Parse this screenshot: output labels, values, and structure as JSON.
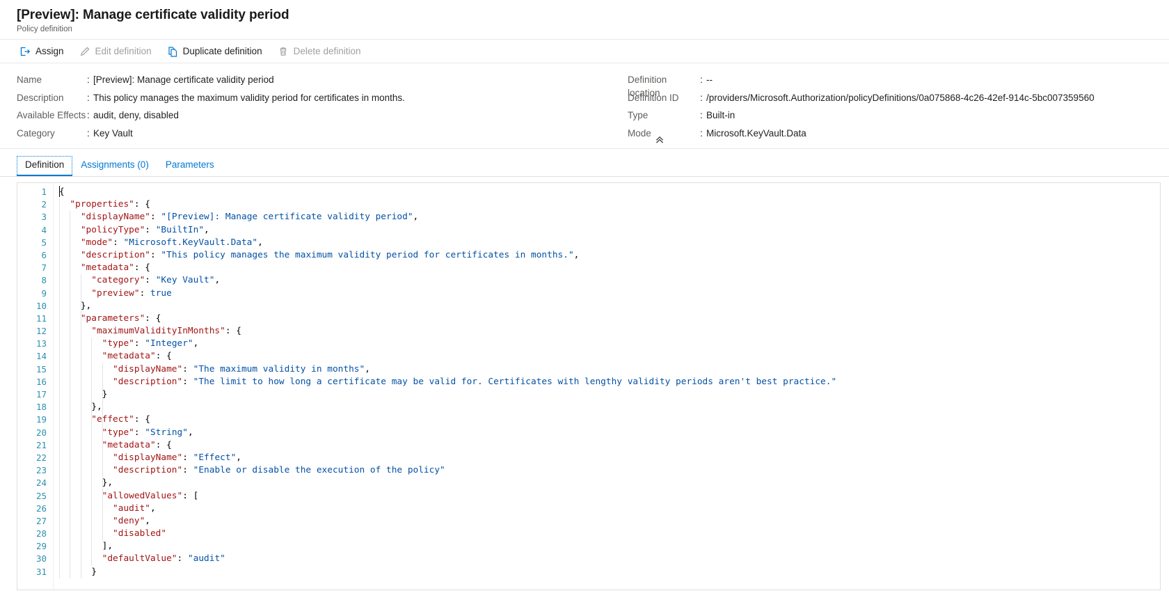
{
  "header": {
    "title": "[Preview]: Manage certificate validity period",
    "subtitle": "Policy definition"
  },
  "command_bar": {
    "items": [
      {
        "label": "Assign",
        "icon": "assign-icon",
        "disabled": false
      },
      {
        "label": "Edit definition",
        "icon": "pencil-icon",
        "disabled": true
      },
      {
        "label": "Duplicate definition",
        "icon": "copy-icon",
        "disabled": false
      },
      {
        "label": "Delete definition",
        "icon": "trash-icon",
        "disabled": true
      }
    ]
  },
  "properties": {
    "separator": ":",
    "left": [
      {
        "label": "Name",
        "value": "[Preview]: Manage certificate validity period"
      },
      {
        "label": "Description",
        "value": "This policy manages the maximum validity period for certificates in months."
      },
      {
        "label": "Available Effects",
        "value": "audit, deny, disabled"
      },
      {
        "label": "Category",
        "value": "Key Vault"
      }
    ],
    "right": [
      {
        "label": "Definition location",
        "value": "--"
      },
      {
        "label": "Definition ID",
        "value": "/providers/Microsoft.Authorization/policyDefinitions/0a075868-4c26-42ef-914c-5bc007359560"
      },
      {
        "label": "Type",
        "value": "Built-in"
      },
      {
        "label": "Mode",
        "value": "Microsoft.KeyVault.Data"
      }
    ],
    "collapse_icon": "chevron-double-up-icon"
  },
  "tabs": [
    {
      "label": "Definition",
      "active": true
    },
    {
      "label": "Assignments (0)",
      "active": false
    },
    {
      "label": "Parameters",
      "active": false
    }
  ],
  "editor": {
    "language": "json",
    "first_visible_line": 1,
    "last_visible_line": 31,
    "colors": {
      "key": "#a31515",
      "string": "#0451a5",
      "punctuation": "#000000",
      "line_number": "#2b91af"
    },
    "line_numbers": [
      1,
      2,
      3,
      4,
      5,
      6,
      7,
      8,
      9,
      10,
      11,
      12,
      13,
      14,
      15,
      16,
      17,
      18,
      19,
      20,
      21,
      22,
      23,
      24,
      25,
      26,
      27,
      28,
      29,
      30,
      31
    ],
    "lines": [
      {
        "n": 1,
        "indent": 0,
        "tokens": [
          {
            "t": "pun",
            "v": "{"
          }
        ]
      },
      {
        "n": 2,
        "indent": 1,
        "tokens": [
          {
            "t": "key",
            "v": "\"properties\""
          },
          {
            "t": "pun",
            "v": ": {"
          }
        ]
      },
      {
        "n": 3,
        "indent": 2,
        "tokens": [
          {
            "t": "key",
            "v": "\"displayName\""
          },
          {
            "t": "pun",
            "v": ": "
          },
          {
            "t": "str",
            "v": "\"[Preview]: Manage certificate validity period\""
          },
          {
            "t": "pun",
            "v": ","
          }
        ]
      },
      {
        "n": 4,
        "indent": 2,
        "tokens": [
          {
            "t": "key",
            "v": "\"policyType\""
          },
          {
            "t": "pun",
            "v": ": "
          },
          {
            "t": "str",
            "v": "\"BuiltIn\""
          },
          {
            "t": "pun",
            "v": ","
          }
        ]
      },
      {
        "n": 5,
        "indent": 2,
        "tokens": [
          {
            "t": "key",
            "v": "\"mode\""
          },
          {
            "t": "pun",
            "v": ": "
          },
          {
            "t": "str",
            "v": "\"Microsoft.KeyVault.Data\""
          },
          {
            "t": "pun",
            "v": ","
          }
        ]
      },
      {
        "n": 6,
        "indent": 2,
        "tokens": [
          {
            "t": "key",
            "v": "\"description\""
          },
          {
            "t": "pun",
            "v": ": "
          },
          {
            "t": "str",
            "v": "\"This policy manages the maximum validity period for certificates in months.\""
          },
          {
            "t": "pun",
            "v": ","
          }
        ]
      },
      {
        "n": 7,
        "indent": 2,
        "tokens": [
          {
            "t": "key",
            "v": "\"metadata\""
          },
          {
            "t": "pun",
            "v": ": {"
          }
        ]
      },
      {
        "n": 8,
        "indent": 3,
        "tokens": [
          {
            "t": "key",
            "v": "\"category\""
          },
          {
            "t": "pun",
            "v": ": "
          },
          {
            "t": "str",
            "v": "\"Key Vault\""
          },
          {
            "t": "pun",
            "v": ","
          }
        ]
      },
      {
        "n": 9,
        "indent": 3,
        "tokens": [
          {
            "t": "key",
            "v": "\"preview\""
          },
          {
            "t": "pun",
            "v": ": "
          },
          {
            "t": "lit",
            "v": "true"
          }
        ]
      },
      {
        "n": 10,
        "indent": 2,
        "tokens": [
          {
            "t": "pun",
            "v": "},"
          }
        ]
      },
      {
        "n": 11,
        "indent": 2,
        "tokens": [
          {
            "t": "key",
            "v": "\"parameters\""
          },
          {
            "t": "pun",
            "v": ": {"
          }
        ]
      },
      {
        "n": 12,
        "indent": 3,
        "tokens": [
          {
            "t": "key",
            "v": "\"maximumValidityInMonths\""
          },
          {
            "t": "pun",
            "v": ": {"
          }
        ]
      },
      {
        "n": 13,
        "indent": 4,
        "tokens": [
          {
            "t": "key",
            "v": "\"type\""
          },
          {
            "t": "pun",
            "v": ": "
          },
          {
            "t": "str",
            "v": "\"Integer\""
          },
          {
            "t": "pun",
            "v": ","
          }
        ]
      },
      {
        "n": 14,
        "indent": 4,
        "tokens": [
          {
            "t": "key",
            "v": "\"metadata\""
          },
          {
            "t": "pun",
            "v": ": {"
          }
        ]
      },
      {
        "n": 15,
        "indent": 5,
        "tokens": [
          {
            "t": "key",
            "v": "\"displayName\""
          },
          {
            "t": "pun",
            "v": ": "
          },
          {
            "t": "str",
            "v": "\"The maximum validity in months\""
          },
          {
            "t": "pun",
            "v": ","
          }
        ]
      },
      {
        "n": 16,
        "indent": 5,
        "tokens": [
          {
            "t": "key",
            "v": "\"description\""
          },
          {
            "t": "pun",
            "v": ": "
          },
          {
            "t": "str",
            "v": "\"The limit to how long a certificate may be valid for. Certificates with lengthy validity periods aren't best practice.\""
          }
        ]
      },
      {
        "n": 17,
        "indent": 4,
        "tokens": [
          {
            "t": "pun",
            "v": "}"
          }
        ]
      },
      {
        "n": 18,
        "indent": 3,
        "tokens": [
          {
            "t": "pun",
            "v": "},"
          }
        ]
      },
      {
        "n": 19,
        "indent": 3,
        "tokens": [
          {
            "t": "key",
            "v": "\"effect\""
          },
          {
            "t": "pun",
            "v": ": {"
          }
        ]
      },
      {
        "n": 20,
        "indent": 4,
        "tokens": [
          {
            "t": "key",
            "v": "\"type\""
          },
          {
            "t": "pun",
            "v": ": "
          },
          {
            "t": "str",
            "v": "\"String\""
          },
          {
            "t": "pun",
            "v": ","
          }
        ]
      },
      {
        "n": 21,
        "indent": 4,
        "tokens": [
          {
            "t": "key",
            "v": "\"metadata\""
          },
          {
            "t": "pun",
            "v": ": {"
          }
        ]
      },
      {
        "n": 22,
        "indent": 5,
        "tokens": [
          {
            "t": "key",
            "v": "\"displayName\""
          },
          {
            "t": "pun",
            "v": ": "
          },
          {
            "t": "str",
            "v": "\"Effect\""
          },
          {
            "t": "pun",
            "v": ","
          }
        ]
      },
      {
        "n": 23,
        "indent": 5,
        "tokens": [
          {
            "t": "key",
            "v": "\"description\""
          },
          {
            "t": "pun",
            "v": ": "
          },
          {
            "t": "str",
            "v": "\"Enable or disable the execution of the policy\""
          }
        ]
      },
      {
        "n": 24,
        "indent": 4,
        "tokens": [
          {
            "t": "pun",
            "v": "},"
          }
        ]
      },
      {
        "n": 25,
        "indent": 4,
        "tokens": [
          {
            "t": "key",
            "v": "\"allowedValues\""
          },
          {
            "t": "pun",
            "v": ": ["
          }
        ]
      },
      {
        "n": 26,
        "indent": 5,
        "tokens": [
          {
            "t": "key",
            "v": "\"audit\""
          },
          {
            "t": "pun",
            "v": ","
          }
        ]
      },
      {
        "n": 27,
        "indent": 5,
        "tokens": [
          {
            "t": "key",
            "v": "\"deny\""
          },
          {
            "t": "pun",
            "v": ","
          }
        ]
      },
      {
        "n": 28,
        "indent": 5,
        "tokens": [
          {
            "t": "key",
            "v": "\"disabled\""
          }
        ]
      },
      {
        "n": 29,
        "indent": 4,
        "tokens": [
          {
            "t": "pun",
            "v": "],"
          }
        ]
      },
      {
        "n": 30,
        "indent": 4,
        "tokens": [
          {
            "t": "key",
            "v": "\"defaultValue\""
          },
          {
            "t": "pun",
            "v": ": "
          },
          {
            "t": "str",
            "v": "\"audit\""
          }
        ]
      },
      {
        "n": 31,
        "indent": 3,
        "tokens": [
          {
            "t": "pun",
            "v": "}"
          }
        ]
      }
    ]
  }
}
